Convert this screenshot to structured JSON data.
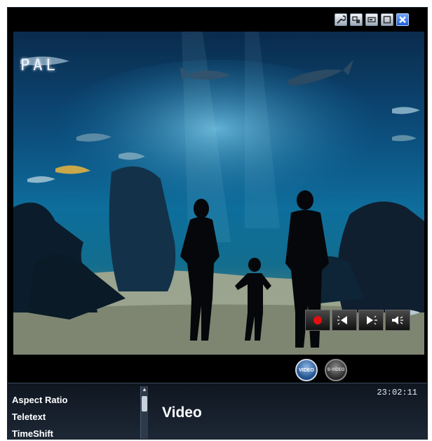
{
  "window": {
    "controls": [
      {
        "name": "settings-button",
        "icon": "wrench-icon"
      },
      {
        "name": "snapshot-button",
        "icon": "window-icon"
      },
      {
        "name": "minimize-button",
        "icon": "minimize-icon"
      },
      {
        "name": "maximize-button",
        "icon": "maximize-icon"
      },
      {
        "name": "close-button",
        "icon": "close-icon"
      }
    ]
  },
  "video": {
    "signal_label": "PAL"
  },
  "playback": {
    "buttons": [
      {
        "name": "record-button",
        "icon": "record-icon",
        "color": "#e01010"
      },
      {
        "name": "rewind-button",
        "icon": "skip-back-icon"
      },
      {
        "name": "forward-button",
        "icon": "skip-forward-icon"
      },
      {
        "name": "volume-button",
        "icon": "speaker-icon"
      }
    ]
  },
  "sources": {
    "video_label": "VIDEO",
    "svideo_label": "S-VIDEO",
    "active": "VIDEO"
  },
  "menu": {
    "items": [
      "Aspect Ratio",
      "Teletext",
      "TimeShift"
    ]
  },
  "panel": {
    "title": "Video",
    "clock": "23:02:11"
  },
  "colors": {
    "accent": "#1d5fd8",
    "panel_bg": "#1d2836"
  }
}
